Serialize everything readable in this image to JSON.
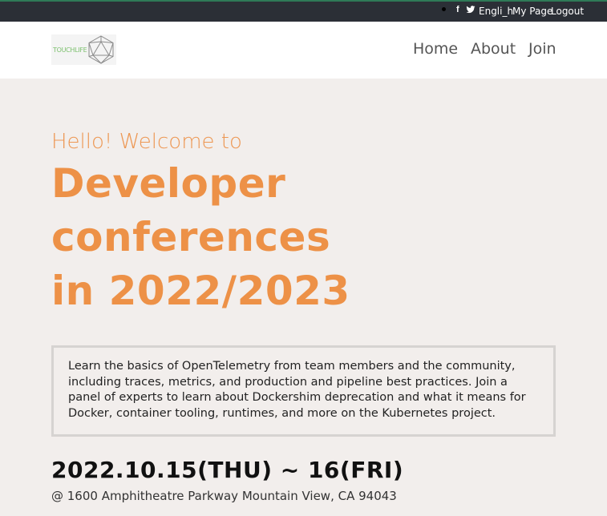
{
  "topbar": {
    "facebook_glyph": "f",
    "language": "Engli_h",
    "my_page": "My Page",
    "logout": "Logout"
  },
  "brand": {
    "logo_text": "TOUCHLIFE"
  },
  "nav": {
    "home": "Home",
    "about": "About",
    "join": "Join"
  },
  "hero": {
    "greeting": "Hello! Welcome to",
    "title_line1": "Developer",
    "title_line2": "conferences",
    "title_line3": "in 2022/2023"
  },
  "description": "Learn the basics of OpenTelemetry from team members and the community, including traces, metrics, and production and pipeline best practices. Join a panel of experts to learn about Dockershim deprecation and what it means for Docker, container tooling, runtimes, and more on the Kubernetes project.",
  "event": {
    "date": "2022.10.15(THU) ~ 16(FRI)",
    "location": "@ 1600 Amphitheatre Parkway Mountain View, CA 94043"
  },
  "colors": {
    "accent": "#ed9147",
    "topbar": "#2b2f36",
    "background": "#f2eeec"
  }
}
